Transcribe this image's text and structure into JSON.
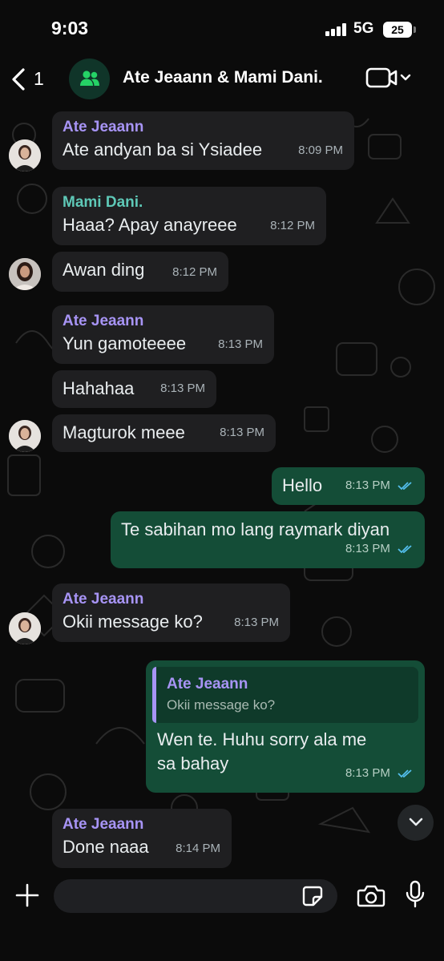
{
  "status_bar": {
    "time": "9:03",
    "network": "5G",
    "battery": "25"
  },
  "header": {
    "back_count": "1",
    "title": "Ate Jeaann & Mami Dani.",
    "icons": {
      "back": "chevron-left-icon",
      "group_avatar": "group-icon",
      "video": "video-camera-icon"
    }
  },
  "messages": [
    {
      "direction": "in",
      "sender": "Ate Jeaann",
      "text": "Ate andyan ba si Ysiadee",
      "time": "8:09 PM"
    },
    {
      "direction": "in",
      "sender": "Mami Dani.",
      "text": "Haaa? Apay anayreee",
      "time": "8:12 PM"
    },
    {
      "direction": "in",
      "sender": "",
      "text": "Awan ding",
      "time": "8:12 PM"
    },
    {
      "direction": "in",
      "sender": "Ate Jeaann",
      "text": "Yun gamoteeee",
      "time": "8:13 PM"
    },
    {
      "direction": "in",
      "sender": "",
      "text": "Hahahaa",
      "time": "8:13 PM"
    },
    {
      "direction": "in",
      "sender": "",
      "text": "Magturok meee",
      "time": "8:13 PM"
    },
    {
      "direction": "out",
      "sender": "",
      "text": "Hello",
      "time": "8:13 PM",
      "status": "read"
    },
    {
      "direction": "out",
      "sender": "",
      "text": "Te sabihan mo lang raymark diyan",
      "time": "8:13 PM",
      "status": "read"
    },
    {
      "direction": "in",
      "sender": "Ate Jeaann",
      "text": "Okii message ko?",
      "time": "8:13 PM"
    },
    {
      "direction": "out",
      "sender": "",
      "quoted_sender": "Ate Jeaann",
      "quoted_text": "Okii message ko?",
      "text": "Wen te. Huhu sorry ala me sa bahay",
      "time": "8:13 PM",
      "status": "read"
    },
    {
      "direction": "in",
      "sender": "Ate Jeaann",
      "text": "Done naaa",
      "time": "8:14 PM"
    }
  ],
  "composer": {
    "placeholder": "",
    "icons": {
      "attach": "plus-icon",
      "sticker": "sticker-icon",
      "camera": "camera-icon",
      "mic": "microphone-icon",
      "scroll": "chevron-down-icon"
    }
  },
  "colors": {
    "background": "#0b0b0b",
    "incoming_bubble": "#1f1f21",
    "outgoing_bubble": "#144d37",
    "sender_purple": "#a794f5",
    "sender_teal": "#5ec8b7",
    "read_ticks": "#53bdeb"
  }
}
